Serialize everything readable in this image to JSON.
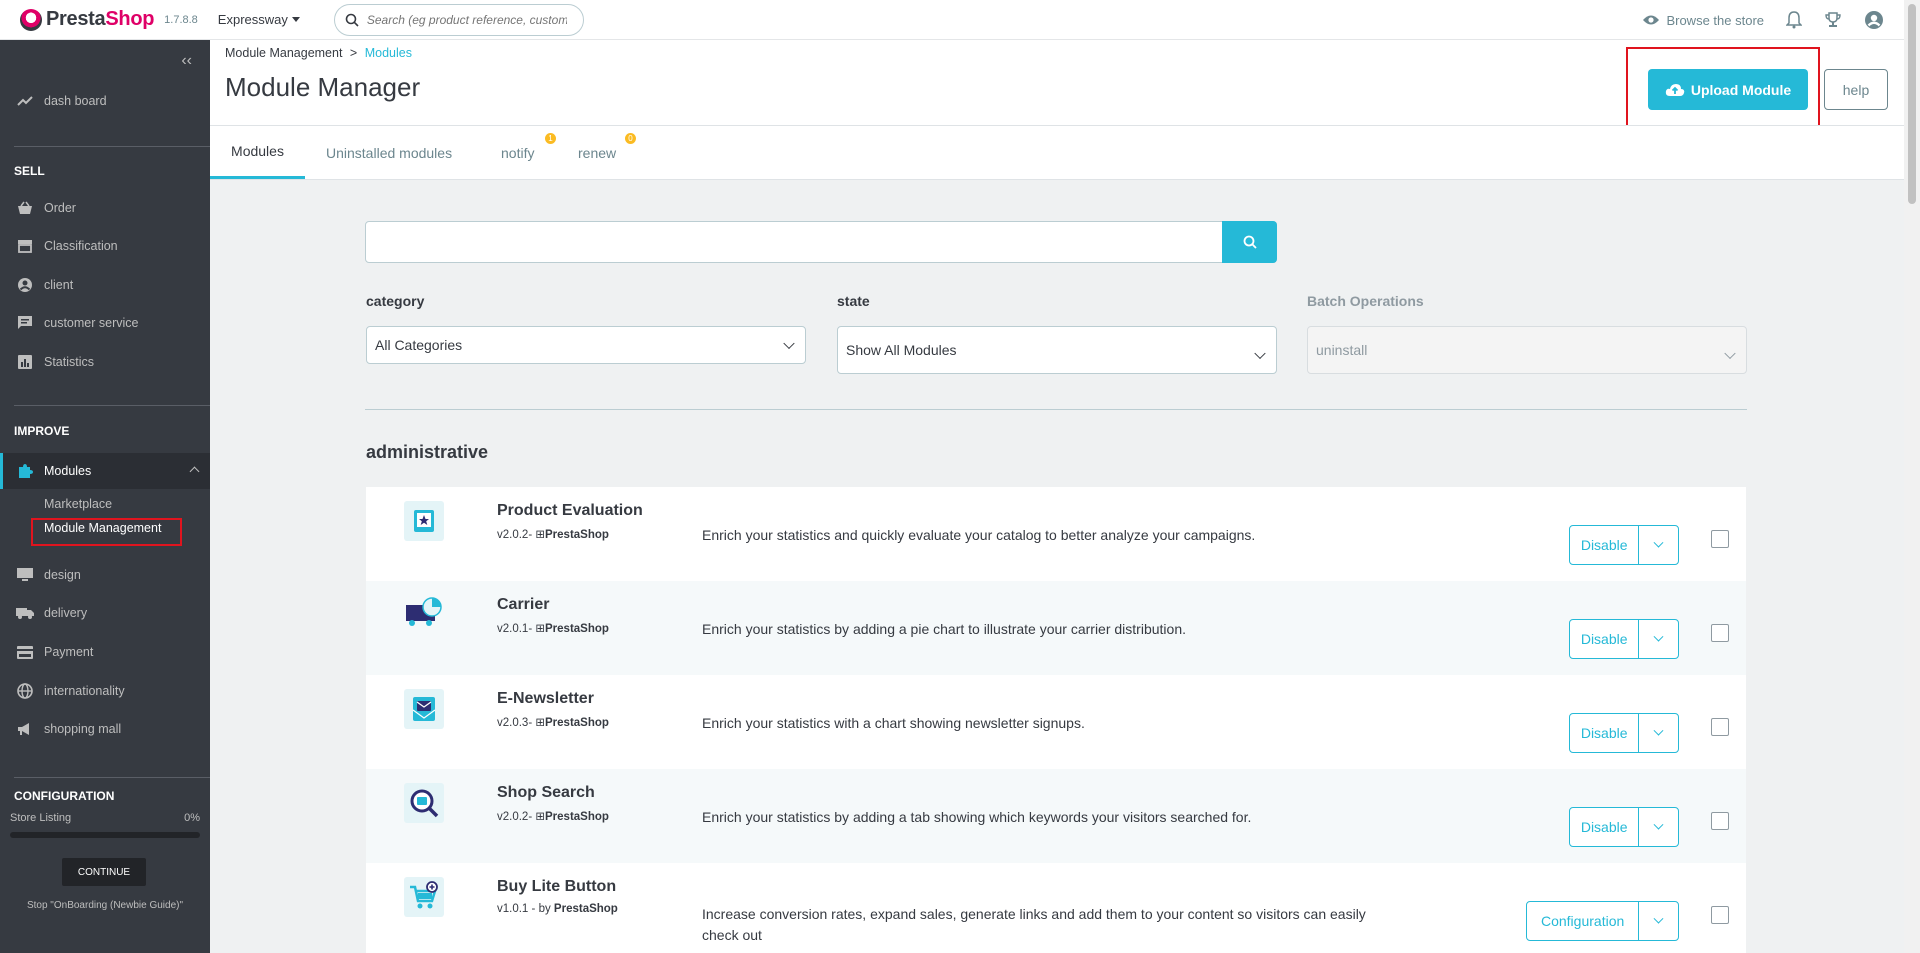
{
  "header": {
    "logo_presta": "Presta",
    "logo_shop": "Shop",
    "version": "1.7.8.8",
    "shop_name": "Expressway",
    "search_placeholder": "Search (eg product reference, custome",
    "browse_store": "Browse the store"
  },
  "sidebar": {
    "dashboard": "dash board",
    "section_sell": "SELL",
    "sell_items": [
      "Order",
      "Classification",
      "client",
      "customer service",
      "Statistics"
    ],
    "section_improve": "IMPROVE",
    "modules": "Modules",
    "modules_sub": [
      "Marketplace",
      "Module Management"
    ],
    "improve_items": [
      "design",
      "delivery",
      "Payment",
      "internationality",
      "shopping mall"
    ],
    "section_config": "CONFIGURATION",
    "onboarding": {
      "label": "Store Listing",
      "percent_text": "0%",
      "progress": 0,
      "continue": "CONTINUE",
      "stop": "Stop \"OnBoarding (Newbie Guide)\""
    }
  },
  "page": {
    "breadcrumb_parent": "Module Management",
    "breadcrumb_sep": ">",
    "breadcrumb_current": "Modules",
    "title": "Module Manager",
    "upload_button": "Upload Module",
    "help_button": "help"
  },
  "tabs": [
    {
      "label": "Modules"
    },
    {
      "label": "Uninstalled modules"
    },
    {
      "label": "notify",
      "badge": "1"
    },
    {
      "label": "renew",
      "badge": "0"
    }
  ],
  "filters": {
    "category_label": "category",
    "category_value": "All Categories",
    "state_label": "state",
    "state_value": "Show All Modules",
    "batch_label": "Batch Operations",
    "batch_value": "uninstall"
  },
  "group_title": "administrative",
  "modules": [
    {
      "name": "Product Evaluation",
      "version": "v2.0.2-",
      "by": "",
      "author": "PrestaShop",
      "description": "Enrich your statistics and quickly evaluate your catalog to better analyze your campaigns.",
      "action": "Disable",
      "icon": "star-book-icon"
    },
    {
      "name": "Carrier",
      "version": "v2.0.1-",
      "by": "",
      "author": "PrestaShop",
      "description": "Enrich your statistics by adding a pie chart to illustrate your carrier distribution.",
      "action": "Disable",
      "icon": "truck-pie-icon"
    },
    {
      "name": "E-Newsletter",
      "version": "v2.0.3-",
      "by": "",
      "author": "PrestaShop",
      "description": "Enrich your statistics with a chart showing newsletter signups.",
      "action": "Disable",
      "icon": "envelope-icon"
    },
    {
      "name": "Shop Search",
      "version": "v2.0.2-",
      "by": "",
      "author": "PrestaShop",
      "description": "Enrich your statistics by adding a tab showing which keywords your visitors searched for.",
      "action": "Disable",
      "icon": "magnifier-shop-icon"
    },
    {
      "name": "Buy Lite Button",
      "version": "v1.0.1 -",
      "by": "by",
      "author": "PrestaShop",
      "description": "Increase conversion rates, expand sales, generate links and add them to your content so visitors can easily check out",
      "action": "Configuration",
      "icon": "cart-plus-icon"
    }
  ],
  "colors": {
    "accent": "#25b9d7",
    "sidebar": "#363a41",
    "brand": "#df0067",
    "badge": "#fbbb22",
    "highlight": "#e0141e"
  }
}
